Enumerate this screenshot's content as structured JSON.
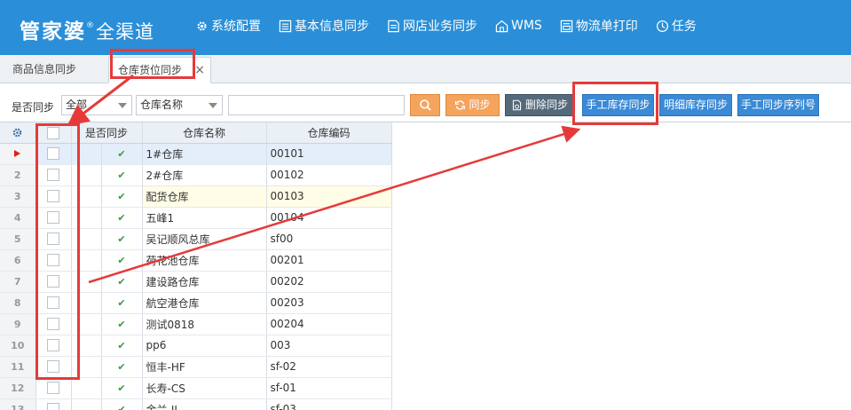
{
  "brand": {
    "name": "管家婆",
    "reg_mark": "®",
    "product": "全渠道"
  },
  "nav": [
    {
      "label": "系统配置",
      "icon": "gear-icon"
    },
    {
      "label": "基本信息同步",
      "icon": "list-icon"
    },
    {
      "label": "网店业务同步",
      "icon": "document-icon"
    },
    {
      "label": "WMS",
      "icon": "warehouse-icon"
    },
    {
      "label": "物流单打印",
      "icon": "print-document-icon"
    },
    {
      "label": "任务",
      "icon": "clock-icon"
    }
  ],
  "tabs": [
    {
      "label": "商品信息同步",
      "active": false
    },
    {
      "label": "仓库货位同步",
      "active": true,
      "close": "×"
    }
  ],
  "toolbar": {
    "sync_label": "是否同步",
    "sync_filter_value": "全部",
    "warehouse_filter_value": "仓库名称",
    "search_value": "",
    "sync_button": "同步",
    "delete_sync_button": "删除同步",
    "manual_stock_sync_button": "手工库存同步",
    "detail_stock_sync_button": "明细库存同步",
    "manual_serial_sync_button": "手工同步序列号"
  },
  "grid": {
    "columns": {
      "sync": "是否同步",
      "name": "仓库名称",
      "code": "仓库编码"
    },
    "check_mark": "✔",
    "rows": [
      {
        "num": "",
        "name": "1#仓库",
        "code": "00101"
      },
      {
        "num": "2",
        "name": "2#仓库",
        "code": "00102"
      },
      {
        "num": "3",
        "name": "配货仓库",
        "code": "00103"
      },
      {
        "num": "4",
        "name": "五峰1",
        "code": "00104"
      },
      {
        "num": "5",
        "name": "吴记顺风总库",
        "code": "sf00"
      },
      {
        "num": "6",
        "name": "荷花池仓库",
        "code": "00201"
      },
      {
        "num": "7",
        "name": "建设路仓库",
        "code": "00202"
      },
      {
        "num": "8",
        "name": "航空港仓库",
        "code": "00203"
      },
      {
        "num": "9",
        "name": "测试0818",
        "code": "00204"
      },
      {
        "num": "10",
        "name": "pp6",
        "code": "003"
      },
      {
        "num": "11",
        "name": "恒丰-HF",
        "code": "sf-02"
      },
      {
        "num": "12",
        "name": "长寿-CS",
        "code": "sf-01"
      },
      {
        "num": "13",
        "name": "金兰-JL",
        "code": "sf-03"
      }
    ]
  },
  "colors": {
    "header_bg": "#2a8fd8",
    "annotation": "#e63a3a",
    "orange_button": "#f5a45d",
    "blue_button": "#3a8ad6",
    "dark_button": "#546a7b",
    "check_green": "#3a9a3a"
  }
}
